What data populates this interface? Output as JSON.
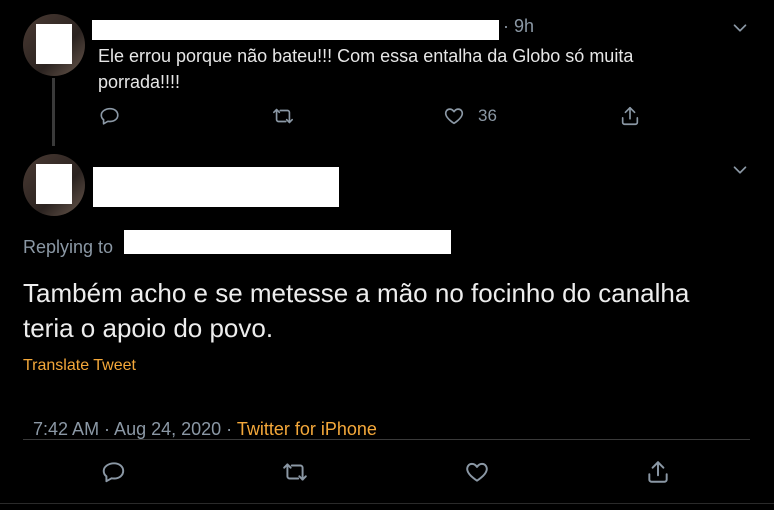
{
  "reply_tweet": {
    "time": "9h",
    "text_line1": "Ele errou porque não bateu!!! Com essa entalha da Globo só muita",
    "text_line2": "porrada!!!!",
    "like_count": "36"
  },
  "main_tweet": {
    "replying_to_label": "Replying to",
    "text_line1": "Também acho e se metesse a mão no focinho do canalha",
    "text_line2": "teria o apoio do povo.",
    "translate_label": "Translate Tweet",
    "timestamp": "7:42 AM · Aug 24, 2020 · ",
    "source": "Twitter for iPhone"
  },
  "icons": {
    "reply": "reply-icon",
    "retweet": "retweet-icon",
    "like": "heart-icon",
    "share": "share-icon",
    "more": "chevron-down-icon"
  },
  "colors": {
    "background": "#000000",
    "accent": "#f4a83a",
    "muted": "#8b98a5"
  }
}
